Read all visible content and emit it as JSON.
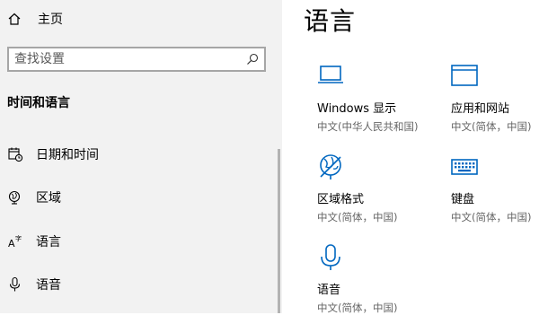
{
  "sidebar": {
    "home_label": "主页",
    "search_placeholder": "查找设置",
    "section_title": "时间和语言",
    "items": [
      {
        "label": "日期和时间",
        "icon": "calendar-clock-icon"
      },
      {
        "label": "区域",
        "icon": "globe-icon"
      },
      {
        "label": "语言",
        "icon": "language-icon"
      },
      {
        "label": "语音",
        "icon": "microphone-icon"
      }
    ]
  },
  "main": {
    "title": "语言",
    "tiles": [
      {
        "title": "Windows 显示",
        "subtitle": "中文(中华人民共和国)",
        "icon": "monitor-icon"
      },
      {
        "title": "应用和网站",
        "subtitle": "中文(简体，中国)",
        "icon": "window-icon"
      },
      {
        "title": "区域格式",
        "subtitle": "中文(简体，中国)",
        "icon": "globe-format-icon"
      },
      {
        "title": "键盘",
        "subtitle": "中文(简体，中国)",
        "icon": "keyboard-icon"
      },
      {
        "title": "语音",
        "subtitle": "中文(简体，中国)",
        "icon": "microphone-icon"
      }
    ]
  },
  "colors": {
    "accent": "#0067c0",
    "sidebar_bg": "#f2f2f2",
    "subtitle": "#666666"
  }
}
